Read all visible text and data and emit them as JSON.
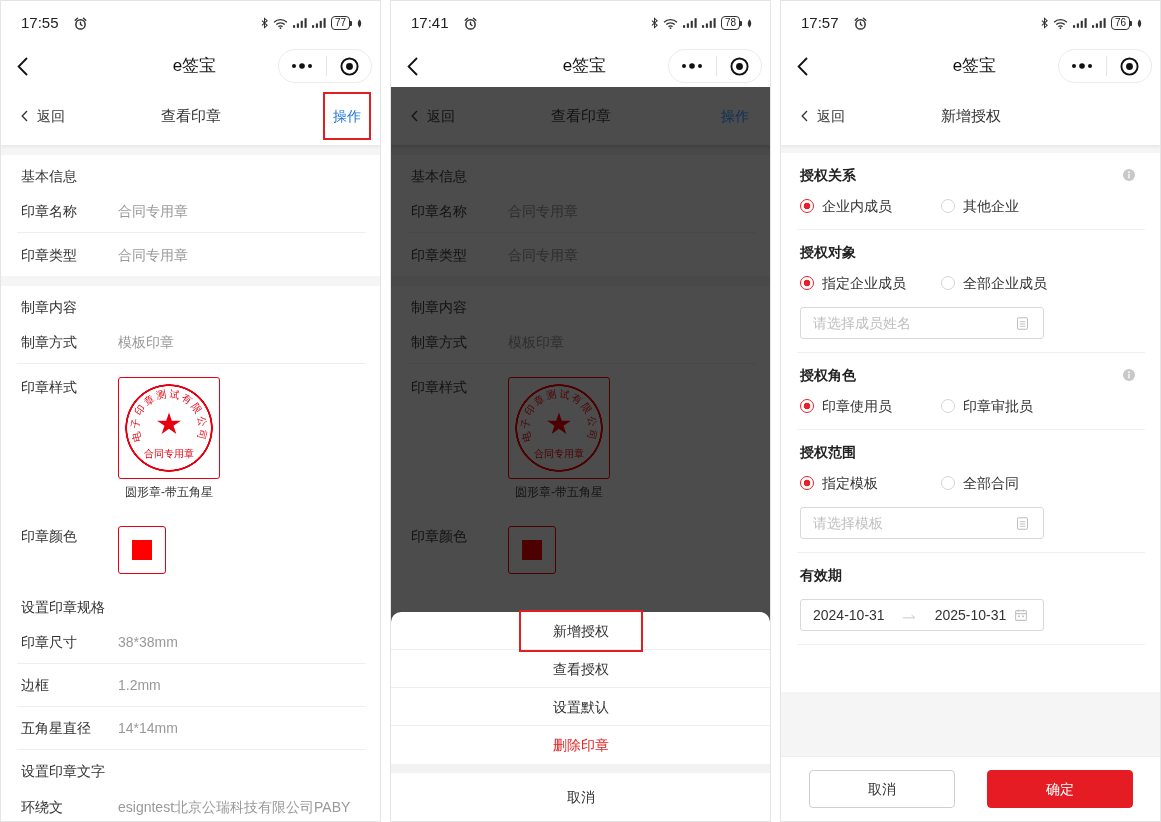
{
  "screens": [
    {
      "kind": "seal_detail",
      "dimmed": false,
      "status_bar": {
        "time": "17:55",
        "battery": "77"
      },
      "nav_bar": {
        "title": "e签宝"
      },
      "header": {
        "back": "返回",
        "title": "查看印章",
        "action": {
          "label": "操作",
          "highlighted": true
        }
      },
      "cards": [
        {
          "sections": [
            {
              "title": "基本信息",
              "rows": [
                {
                  "kind": "text",
                  "label": "印章名称",
                  "value": "合同专用章"
                },
                {
                  "kind": "text",
                  "label": "印章类型",
                  "value": "合同专用章"
                }
              ]
            }
          ]
        },
        {
          "sections": [
            {
              "title": "制章内容",
              "rows": [
                {
                  "kind": "text",
                  "label": "制章方式",
                  "value": "模板印章"
                },
                {
                  "kind": "seal",
                  "label": "印章样式",
                  "ring_text": "电子印章测试有限公司",
                  "center_text": "合同专用章",
                  "caption": "圆形章-带五角星"
                },
                {
                  "kind": "color",
                  "label": "印章颜色",
                  "color": "#ff0000"
                }
              ]
            },
            {
              "title": "设置印章规格",
              "rows": [
                {
                  "kind": "text",
                  "label": "印章尺寸",
                  "value": "38*38mm"
                },
                {
                  "kind": "text",
                  "label": "边框",
                  "value": "1.2mm"
                },
                {
                  "kind": "text",
                  "label": "五角星直径",
                  "value": "14*14mm"
                }
              ]
            },
            {
              "title": "设置印章文字",
              "rows": [
                {
                  "kind": "text",
                  "label": "环绕文",
                  "value": "esigntest北京公瑞科技有限公司PABY"
                }
              ]
            }
          ]
        }
      ]
    },
    {
      "kind": "seal_detail",
      "dimmed": true,
      "status_bar": {
        "time": "17:41",
        "battery": "78"
      },
      "nav_bar": {
        "title": "e签宝"
      },
      "header": {
        "back": "返回",
        "title": "查看印章",
        "action": {
          "label": "操作",
          "highlighted": false
        }
      },
      "cards": [
        {
          "sections": [
            {
              "title": "基本信息",
              "rows": [
                {
                  "kind": "text",
                  "label": "印章名称",
                  "value": "合同专用章"
                },
                {
                  "kind": "text",
                  "label": "印章类型",
                  "value": "合同专用章"
                }
              ]
            }
          ]
        },
        {
          "sections": [
            {
              "title": "制章内容",
              "rows": [
                {
                  "kind": "text",
                  "label": "制章方式",
                  "value": "模板印章"
                },
                {
                  "kind": "seal",
                  "label": "印章样式",
                  "ring_text": "电子印章测试有限公司",
                  "center_text": "合同专用章",
                  "caption": "圆形章-带五角星"
                },
                {
                  "kind": "color",
                  "label": "印章颜色",
                  "color": "#4d0000"
                }
              ]
            }
          ]
        }
      ],
      "action_sheet": {
        "items": [
          {
            "label": "新增授权",
            "kind": "normal",
            "highlighted": true
          },
          {
            "label": "查看授权",
            "kind": "normal",
            "highlighted": false
          },
          {
            "label": "设置默认",
            "kind": "normal",
            "highlighted": false
          },
          {
            "label": "删除印章",
            "kind": "danger",
            "highlighted": false
          }
        ],
        "cancel": "取消"
      }
    },
    {
      "kind": "authorization_form",
      "dimmed": false,
      "status_bar": {
        "time": "17:57",
        "battery": "76"
      },
      "nav_bar": {
        "title": "e签宝"
      },
      "header": {
        "back": "返回",
        "title": "新增授权"
      },
      "groups": [
        {
          "title": "授权关系",
          "info": true,
          "options": [
            {
              "label": "企业内成员",
              "selected": true
            },
            {
              "label": "其他企业",
              "selected": false
            }
          ]
        },
        {
          "title": "授权对象",
          "info": false,
          "options": [
            {
              "label": "指定企业成员",
              "selected": true
            },
            {
              "label": "全部企业成员",
              "selected": false
            }
          ],
          "field": {
            "placeholder": "请选择成员姓名"
          }
        },
        {
          "title": "授权角色",
          "info": true,
          "options": [
            {
              "label": "印章使用员",
              "selected": true
            },
            {
              "label": "印章审批员",
              "selected": false
            }
          ]
        },
        {
          "title": "授权范围",
          "info": false,
          "options": [
            {
              "label": "指定模板",
              "selected": true
            },
            {
              "label": "全部合同",
              "selected": false
            }
          ],
          "field": {
            "placeholder": "请选择模板"
          }
        },
        {
          "title": "有效期",
          "info": false,
          "date_range": {
            "start": "2024-10-31",
            "end": "2025-10-31"
          }
        }
      ],
      "footer": {
        "cancel": "取消",
        "confirm": "确定"
      }
    }
  ]
}
